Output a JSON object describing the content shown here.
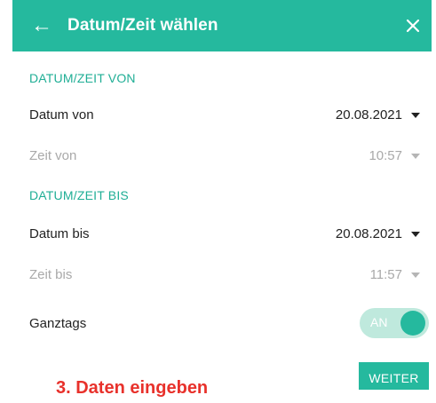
{
  "appbar": {
    "title": "Datum/Zeit wählen",
    "color": "#25b99e",
    "back_icon": "arrow-left-icon",
    "close_icon": "close-icon"
  },
  "from": {
    "section_title": "DATUM/ZEIT VON",
    "date_label": "Datum von",
    "date_value": "20.08.2021",
    "time_label": "Zeit von",
    "time_value": "10:57"
  },
  "to": {
    "section_title": "DATUM/ZEIT BIS",
    "date_label": "Datum bis",
    "date_value": "20.08.2021",
    "time_label": "Zeit bis",
    "time_value": "11:57"
  },
  "allday": {
    "label": "Ganztags",
    "toggle_text": "AN",
    "checked": true
  },
  "actions": {
    "next_label": "WEITER"
  },
  "annotation": {
    "step_text": "3. Daten eingeben",
    "color": "#e8312b"
  }
}
